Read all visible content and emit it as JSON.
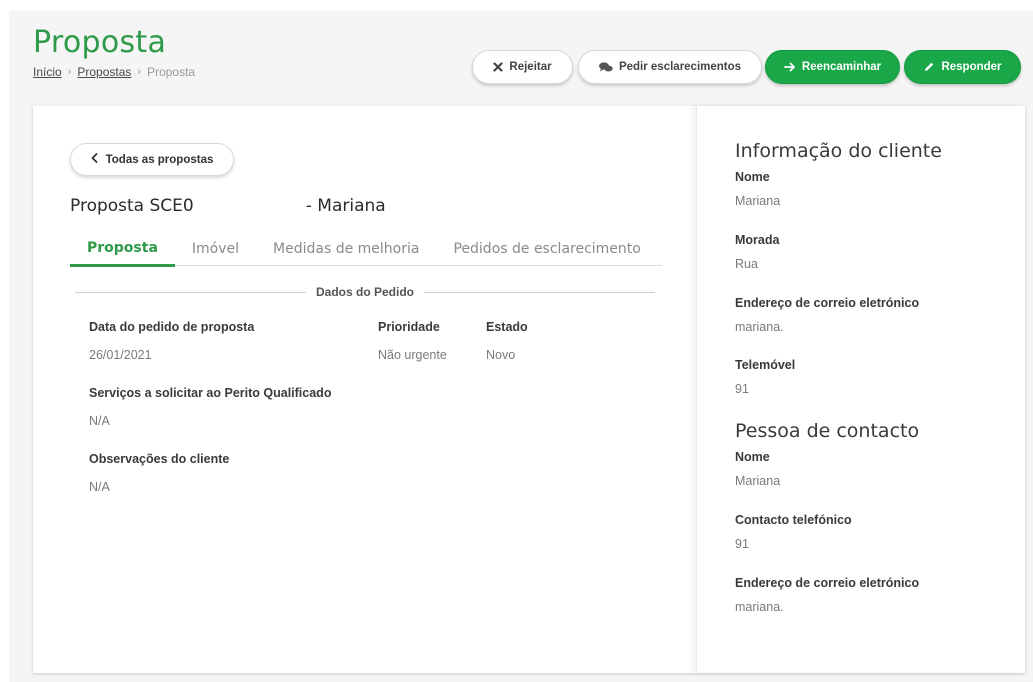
{
  "header": {
    "title": "Proposta",
    "breadcrumb": {
      "home": "Início",
      "proposals": "Propostas",
      "current": "Proposta"
    }
  },
  "actions": {
    "reject": "Rejeitar",
    "clarify": "Pedir esclarecimentos",
    "forward": "Reencaminhar",
    "respond": "Responder"
  },
  "main": {
    "back": "Todas as propostas",
    "proposal_code": "Proposta SCE0",
    "proposal_name": "- Mariana",
    "tabs": [
      {
        "label": "Proposta",
        "active": true
      },
      {
        "label": "Imóvel",
        "active": false
      },
      {
        "label": "Medidas de melhoria",
        "active": false
      },
      {
        "label": "Pedidos de esclarecimento",
        "active": false
      }
    ],
    "section_title": "Dados do Pedido",
    "fields": {
      "request_date_label": "Data do pedido de proposta",
      "request_date_value": "26/01/2021",
      "priority_label": "Prioridade",
      "priority_value": "Não urgente",
      "status_label": "Estado",
      "status_value": "Novo",
      "services_label": "Serviços a solicitar ao Perito Qualificado",
      "services_value": "N/A",
      "notes_label": "Observações do cliente",
      "notes_value": "N/A"
    }
  },
  "client": {
    "heading": "Informação do cliente",
    "name_label": "Nome",
    "name_value": "Mariana",
    "address_label": "Morada",
    "address_value": "Rua",
    "email_label": "Endereço de correio eletrónico",
    "email_value": "mariana.",
    "mobile_label": "Telemóvel",
    "mobile_value": "91"
  },
  "contact": {
    "heading": "Pessoa de contacto",
    "name_label": "Nome",
    "name_value": "Mariana",
    "phone_label": "Contacto telefónico",
    "phone_value": "91",
    "email_label": "Endereço de correio eletrónico",
    "email_value": "mariana."
  },
  "colors": {
    "accent": "#2e9a4a",
    "button_green": "#19a748"
  }
}
